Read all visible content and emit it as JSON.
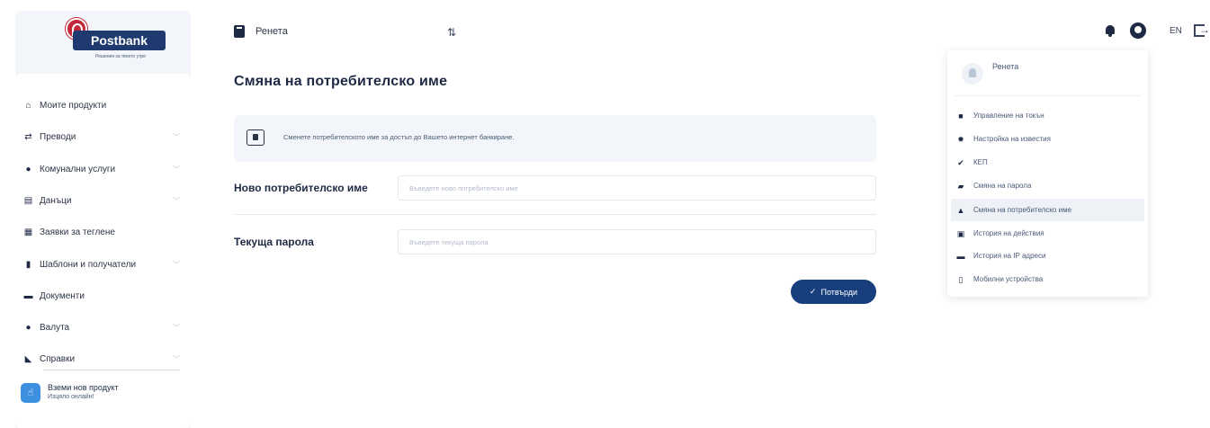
{
  "brand": {
    "name": "Postbank",
    "tagline": "Решения за твоето утре"
  },
  "sidebar": {
    "items": [
      {
        "label": "Моите продукти",
        "icon": "home-icon",
        "glyph": "⌂",
        "chevron": false
      },
      {
        "label": "Преводи",
        "icon": "transfer-icon",
        "glyph": "⇄",
        "chevron": true
      },
      {
        "label": "Комунални услуги",
        "icon": "bulb-icon",
        "glyph": "●",
        "chevron": true
      },
      {
        "label": "Данъци",
        "icon": "tax-doc-icon",
        "glyph": "▤",
        "chevron": true
      },
      {
        "label": "Заявки за теглене",
        "icon": "bank-icon",
        "glyph": "▦",
        "chevron": false
      },
      {
        "label": "Шаблони и получатели",
        "icon": "templates-icon",
        "glyph": "▮",
        "chevron": true
      },
      {
        "label": "Документи",
        "icon": "folder-icon",
        "glyph": "▬",
        "chevron": false
      },
      {
        "label": "Валута",
        "icon": "currency-icon",
        "glyph": "●",
        "chevron": true
      },
      {
        "label": "Справки",
        "icon": "reports-icon",
        "glyph": "◣",
        "chevron": true
      }
    ],
    "promo": {
      "title": "Вземи нов продукт",
      "subtitle": "Изцяло онлайн!"
    }
  },
  "topbar": {
    "user_name": "Ренета",
    "language": "EN"
  },
  "page": {
    "title": "Смяна на потребителско име",
    "info": "Сменете потребителското име за достъп до Вашето интернет банкиране.",
    "fields": {
      "new_username": {
        "label": "Ново потребителско име",
        "placeholder": "Въведете ново потребителско име",
        "value": ""
      },
      "current_password": {
        "label": "Текуща парола",
        "placeholder": "Въведете текуща парола",
        "value": ""
      }
    },
    "confirm_label": "Потвърди"
  },
  "dropdown": {
    "user_name": "Ренета",
    "items": [
      {
        "label": "Управление на токън",
        "icon": "token-icon",
        "glyph": "■",
        "active": false
      },
      {
        "label": "Настройка на известия",
        "icon": "gear-icon",
        "glyph": "✹",
        "active": false
      },
      {
        "label": "КЕП",
        "icon": "shield-check-icon",
        "glyph": "✔",
        "active": false
      },
      {
        "label": "Смяна на парола",
        "icon": "lock-icon",
        "glyph": "▰",
        "active": false
      },
      {
        "label": "Смяна на потребителско име",
        "icon": "user-icon",
        "glyph": "▲",
        "active": true
      },
      {
        "label": "История на действия",
        "icon": "history-icon",
        "glyph": "▣",
        "active": false
      },
      {
        "label": "История на IP адреси",
        "icon": "monitor-icon",
        "glyph": "▬",
        "active": false
      },
      {
        "label": "Мобилни устройства",
        "icon": "mobile-icon",
        "glyph": "▯",
        "active": false
      }
    ]
  }
}
